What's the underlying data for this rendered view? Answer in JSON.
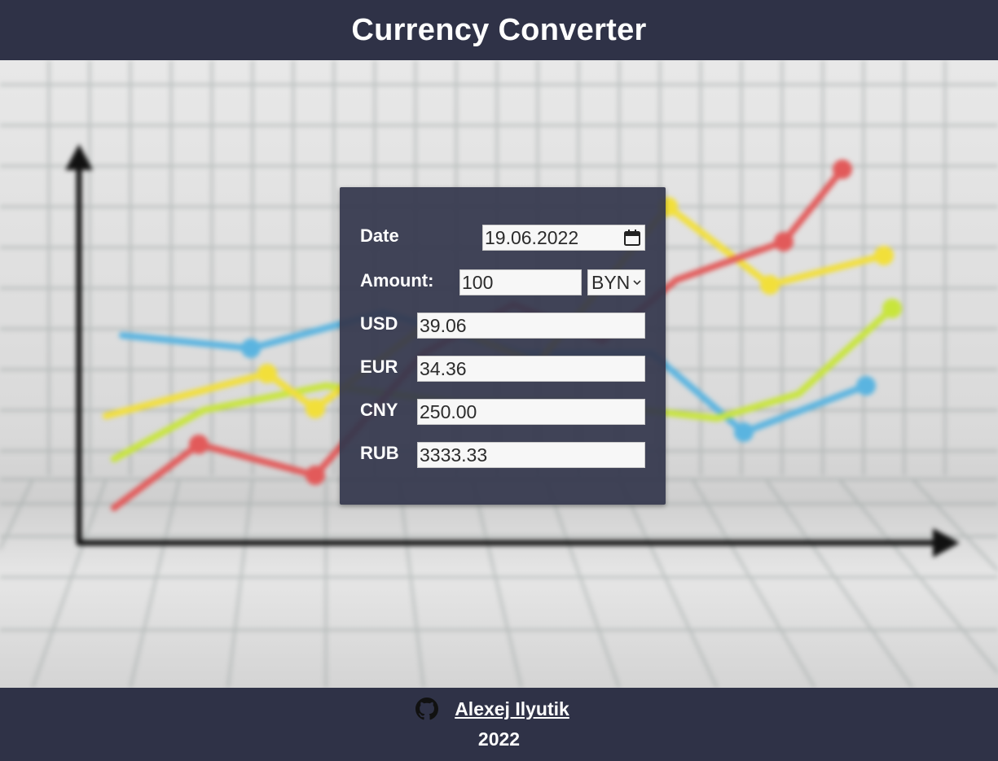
{
  "header": {
    "title": "Currency Converter"
  },
  "converter": {
    "date_label": "Date",
    "date_value": "19.06.2022",
    "amount_label": "Amount:",
    "amount_value": "100",
    "base_currency": "BYN",
    "results": [
      {
        "code": "USD",
        "value": "39.06"
      },
      {
        "code": "EUR",
        "value": "34.36"
      },
      {
        "code": "CNY",
        "value": "250.00"
      },
      {
        "code": "RUB",
        "value": "3333.33"
      }
    ]
  },
  "footer": {
    "author": "Alexej Ilyutik",
    "year": "2022"
  },
  "colors": {
    "header_bg": "#2f3247",
    "card_bg": "#34374c",
    "line_red": "#e25a5a",
    "line_yellow": "#f2df3a",
    "line_lime": "#c8e53c",
    "line_blue": "#5ab4e0"
  },
  "icons": {
    "date": "calendar-icon",
    "select": "chevron-down-icon",
    "author": "github-icon"
  }
}
